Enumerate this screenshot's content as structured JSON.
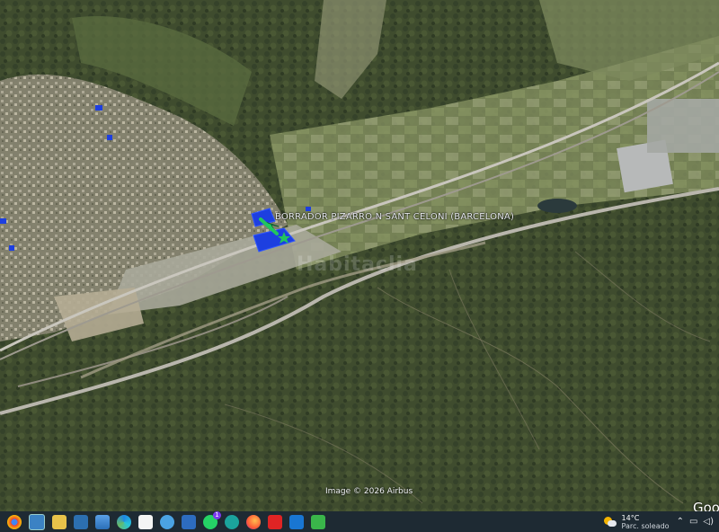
{
  "map": {
    "place_label": "BORRADOR PIZARRO N SANT CELONI (BARCELONA)",
    "watermark": "Habitaclia",
    "attribution": "Image © 2026 Airbus",
    "logo": "Goo",
    "marker_color": "#22c55e",
    "parcel_color": "#1d3fe0"
  },
  "taskbar": {
    "icons": [
      "chrome-icon",
      "app-icon",
      "file-explorer-icon",
      "network-icon",
      "photos-icon",
      "edge-icon",
      "document-icon",
      "browser-icon",
      "save-icon",
      "whatsapp-icon",
      "teams-icon",
      "firefox-icon",
      "acrobat-icon",
      "sketchup-icon",
      "media-icon"
    ],
    "whatsapp_badge": "1",
    "weather": {
      "temp": "14°C",
      "condition": "Parc. soleado"
    }
  }
}
